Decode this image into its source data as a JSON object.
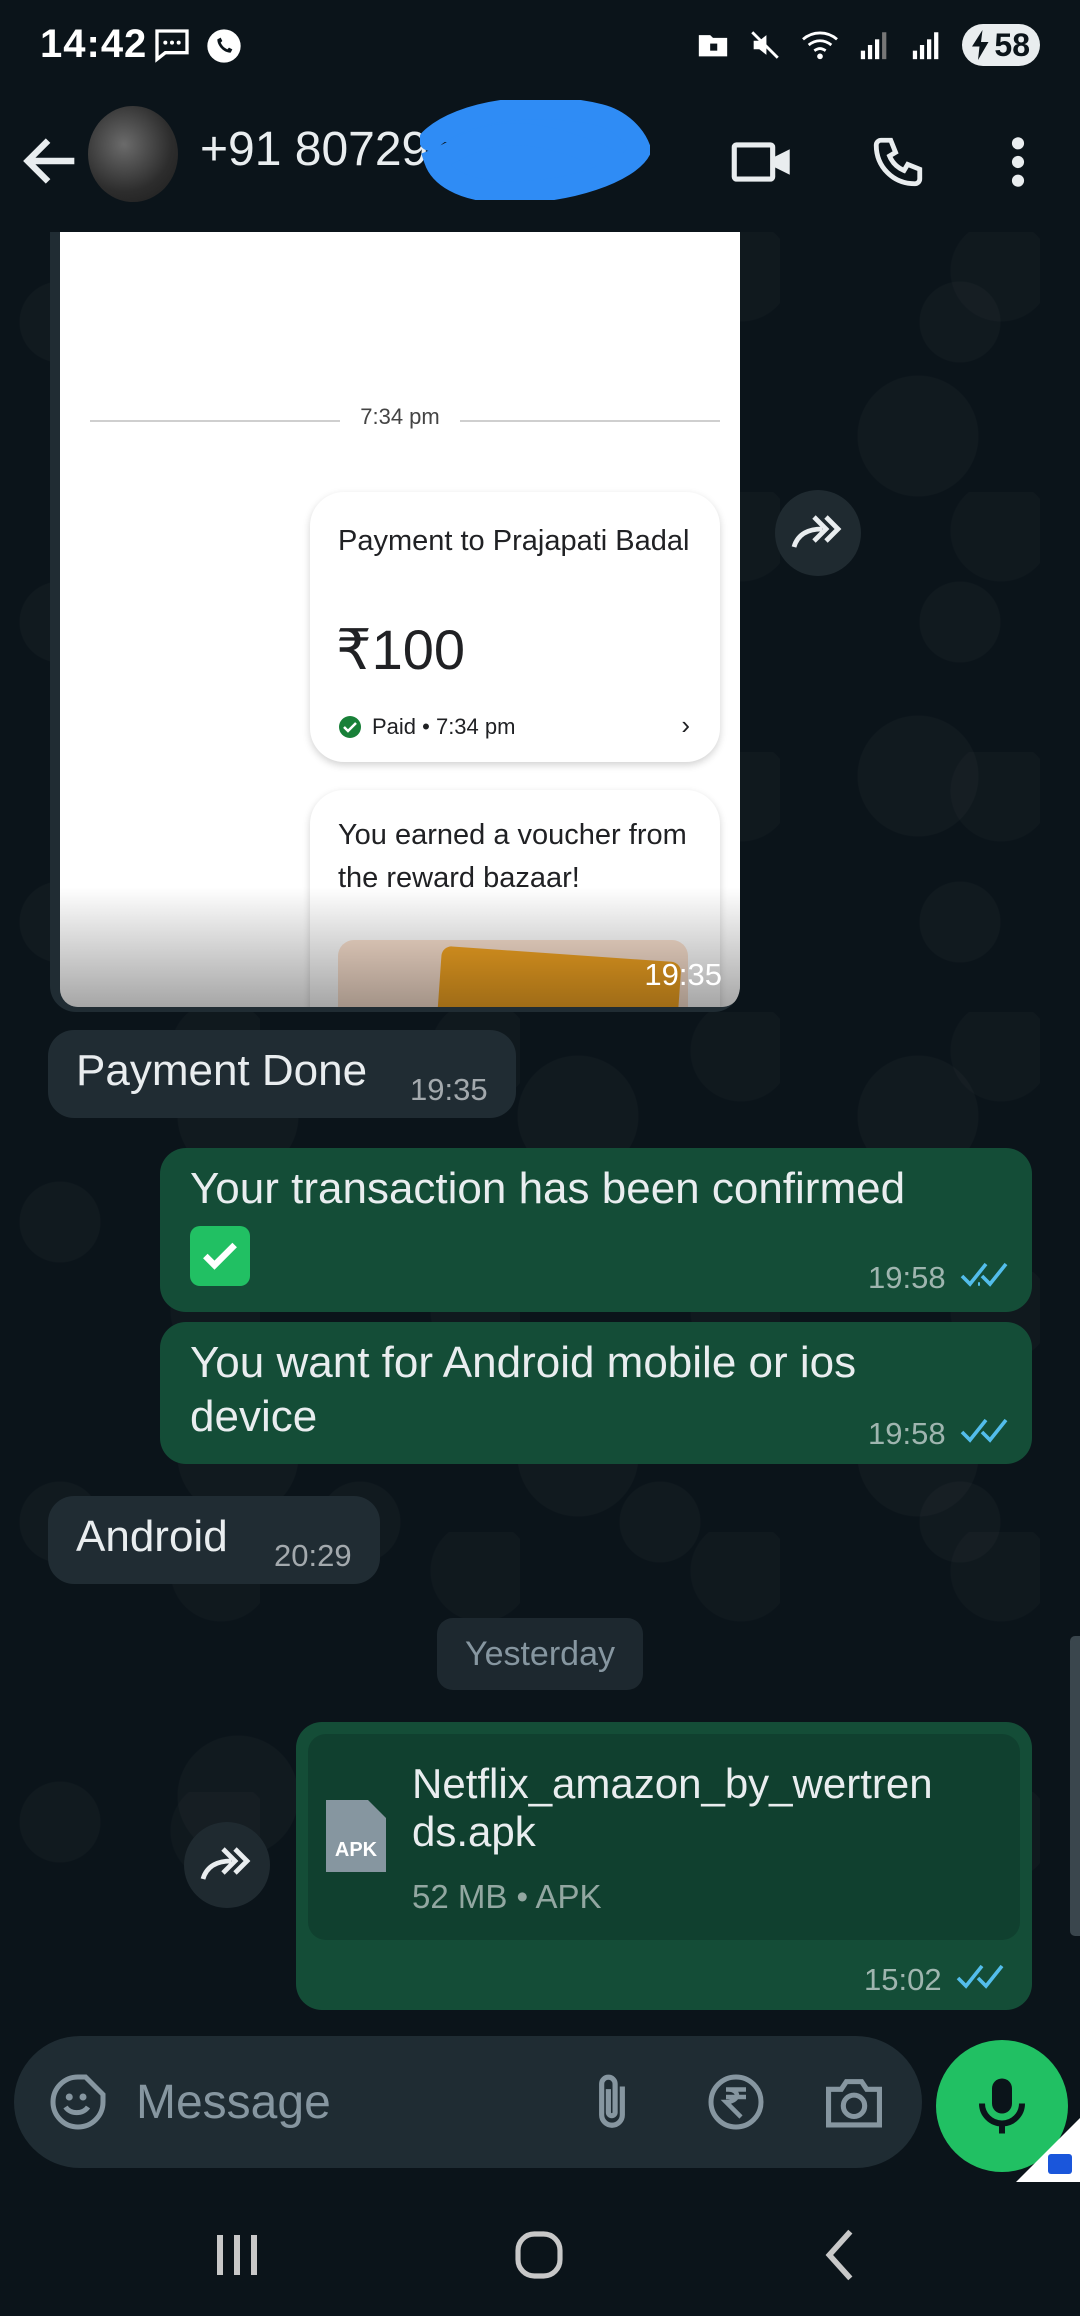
{
  "status_bar": {
    "time": "14:42",
    "battery": "58"
  },
  "header": {
    "contact_name": "+91 80729"
  },
  "image_message": {
    "screenshot_time": "7:34 pm",
    "payment_title": "Payment to Prajapati Badal",
    "amount": "₹100",
    "status": "Paid • 7:34 pm",
    "voucher_text": "You earned a voucher from the reward bazaar!",
    "time": "19:35"
  },
  "messages": [
    {
      "id": "payment-done",
      "direction": "incoming",
      "text": "Payment Done",
      "time": "19:35"
    },
    {
      "id": "transaction-confirmed",
      "direction": "outgoing",
      "text": "Your transaction has been confirmed",
      "emoji": "✅",
      "time": "19:58"
    },
    {
      "id": "android-or-ios",
      "direction": "outgoing",
      "text": "You want for Android mobile or ios device",
      "time": "19:58"
    },
    {
      "id": "android",
      "direction": "incoming",
      "text": "Android",
      "time": "20:29"
    }
  ],
  "date_divider": "Yesterday",
  "document": {
    "icon_label": "APK",
    "file_name": "Netflix_amazon_by_wertrends.apk",
    "meta": "52 MB • APK",
    "time": "15:02"
  },
  "composer": {
    "placeholder": "Message"
  },
  "colors": {
    "background": "#0b141a",
    "incoming_bubble": "#202c33",
    "outgoing_bubble": "#144d37",
    "mic_button": "#21c063",
    "read_ticks": "#53bdeb"
  }
}
